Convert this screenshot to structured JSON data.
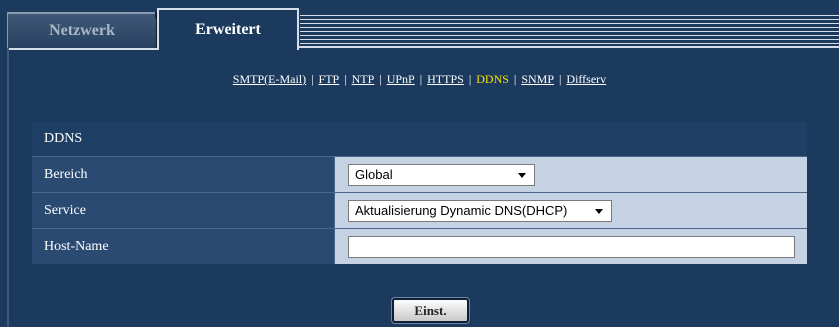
{
  "tabs": [
    {
      "label": "Netzwerk",
      "active": false
    },
    {
      "label": "Erweitert",
      "active": true
    }
  ],
  "subnav": [
    {
      "label": "SMTP(E-Mail)",
      "active": false
    },
    {
      "label": "FTP",
      "active": false
    },
    {
      "label": "NTP",
      "active": false
    },
    {
      "label": "UPnP",
      "active": false
    },
    {
      "label": "HTTPS",
      "active": false
    },
    {
      "label": "DDNS",
      "active": true
    },
    {
      "label": "SNMP",
      "active": false
    },
    {
      "label": "Diffserv",
      "active": false
    }
  ],
  "subnav_separator": "|",
  "section": {
    "title": "DDNS",
    "rows": {
      "bereich": {
        "label": "Bereich",
        "value": "Global"
      },
      "service": {
        "label": "Service",
        "value": "Aktualisierung Dynamic DNS(DHCP)"
      },
      "hostname": {
        "label": "Host-Name",
        "value": ""
      }
    }
  },
  "button": {
    "label": "Einst."
  },
  "colors": {
    "background": "#1b3a5e",
    "row_label_bg": "#2a4a72",
    "row_value_bg": "#c5d2e4",
    "active_link": "#f2e100"
  },
  "icons": {
    "dropdown": "chevron-down-icon"
  }
}
